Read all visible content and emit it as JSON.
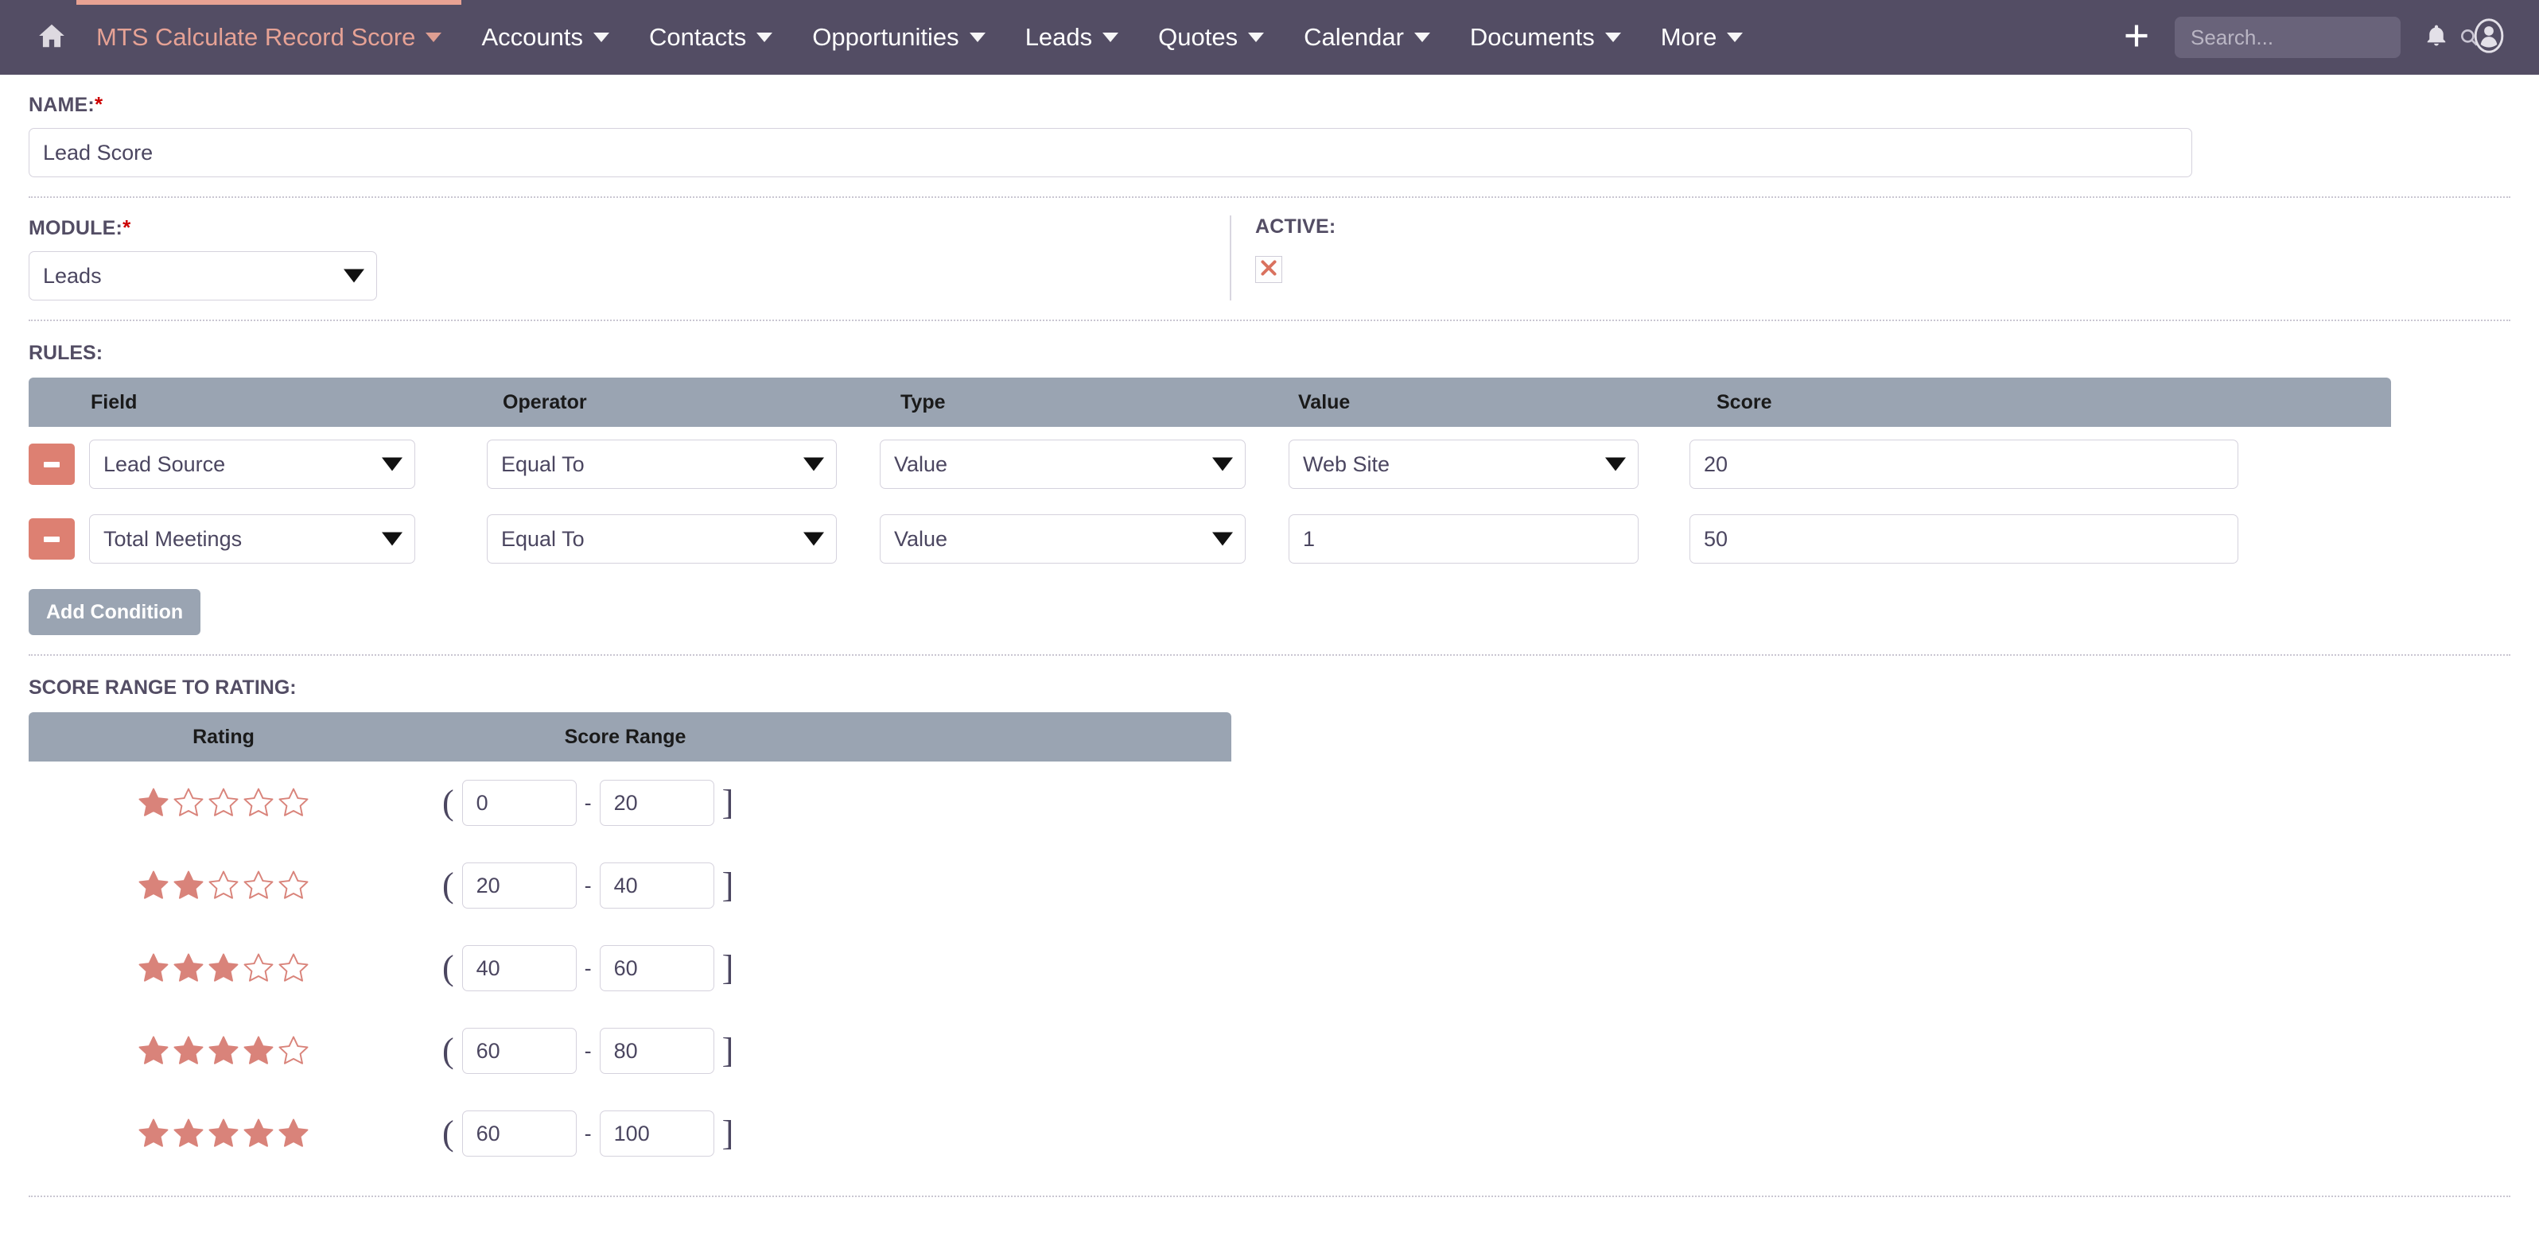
{
  "nav": {
    "home_icon": "home-icon",
    "active_module": "MTS Calculate Record Score",
    "items": [
      {
        "label": "Accounts"
      },
      {
        "label": "Contacts"
      },
      {
        "label": "Opportunities"
      },
      {
        "label": "Leads"
      },
      {
        "label": "Quotes"
      },
      {
        "label": "Calendar"
      },
      {
        "label": "Documents"
      },
      {
        "label": "More"
      }
    ],
    "plus_icon": "plus-icon",
    "search_placeholder": "Search...",
    "search_value": "",
    "search_icon": "search-icon",
    "bell_icon": "bell-icon",
    "avatar_icon": "user-avatar-icon"
  },
  "form": {
    "name_label": "NAME:",
    "name_required": "*",
    "name_value": "Lead Score",
    "module_label": "MODULE:",
    "module_required": "*",
    "module_value": "Leads",
    "active_label": "ACTIVE:",
    "active_checked": "checked"
  },
  "rules": {
    "section_label": "RULES:",
    "columns": [
      "Field",
      "Operator",
      "Type",
      "Value",
      "Score"
    ],
    "rows": [
      {
        "remove": "remove-condition",
        "field": "Lead Source",
        "field_type": "select",
        "operator": "Equal To",
        "operator_type": "select",
        "type": "Value",
        "type_type": "select",
        "value": "Web Site",
        "value_type": "select",
        "score": "20",
        "score_type": "text"
      },
      {
        "remove": "remove-condition",
        "field": "Total Meetings",
        "field_type": "select",
        "operator": "Equal To",
        "operator_type": "select",
        "type": "Value",
        "type_type": "select",
        "value": "1",
        "value_type": "text",
        "score": "50",
        "score_type": "text"
      }
    ],
    "add_button": "Add Condition"
  },
  "score_range": {
    "section_label": "SCORE RANGE TO RATING:",
    "columns": [
      "Rating",
      "Score Range"
    ],
    "open_bracket": "(",
    "close_bracket": "]",
    "dash": "-",
    "rows": [
      {
        "stars": 1,
        "min": "0",
        "max": "20"
      },
      {
        "stars": 2,
        "min": "20",
        "max": "40"
      },
      {
        "stars": 3,
        "min": "40",
        "max": "60"
      },
      {
        "stars": 4,
        "min": "60",
        "max": "80"
      },
      {
        "stars": 5,
        "min": "60",
        "max": "100"
      }
    ]
  },
  "colors": {
    "navbar": "#534d64",
    "accent": "#e8a293",
    "star": "#d9837a",
    "remove_button": "#dd8072",
    "table_header": "#9aa4b2",
    "required": "#cc0000"
  }
}
